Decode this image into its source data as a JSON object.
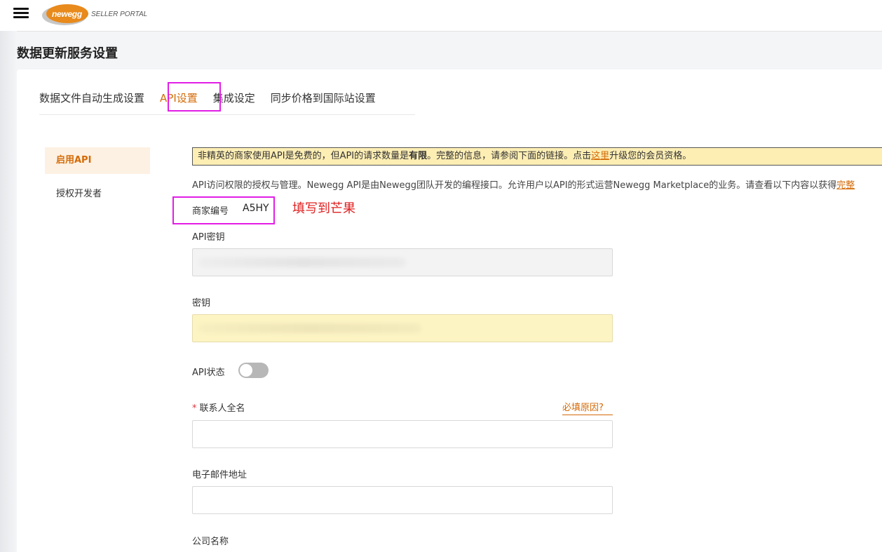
{
  "header": {
    "logo_text": "newegg",
    "portal_label": "SELLER PORTAL"
  },
  "page": {
    "title": "数据更新服务设置"
  },
  "tabs": [
    {
      "label": "数据文件自动生成设置"
    },
    {
      "label": "API设置",
      "active": true
    },
    {
      "label": "集成设定"
    },
    {
      "label": "同步价格到国际站设置"
    }
  ],
  "sidebar": {
    "items": [
      {
        "label": "启用API",
        "active": true
      },
      {
        "label": "授权开发者"
      }
    ]
  },
  "notice": {
    "part1": "非精英的商家使用API是免费的，但API的请求数量是",
    "bold": "有限",
    "part2": "。完整的信息，请参阅下面的链接。点击",
    "link": "这里",
    "part3": "升级您的会员资格。"
  },
  "description": {
    "text": "API访问权限的授权与管理。Newegg API是由Newegg团队开发的编程接口。允许用户以API的形式运营Newegg Marketplace的业务。请查看以下内容以获得",
    "link": "完整"
  },
  "merchant": {
    "label": "商家编号",
    "value": "A5HY",
    "annotation": "填写到芒果"
  },
  "form": {
    "api_key_label": "API密钥",
    "secret_key_label": "密钥",
    "api_status_label": "API状态",
    "api_status_on": false,
    "contact_label": "联系人全名",
    "required_mark": "*",
    "why_required": "必填原因?",
    "email_label": "电子邮件地址",
    "company_label": "公司名称"
  },
  "colors": {
    "accent": "#d46b08",
    "highlight_box": "#e21ee6",
    "annotation": "#e02020",
    "notice_bg": "#fdeeb4"
  }
}
